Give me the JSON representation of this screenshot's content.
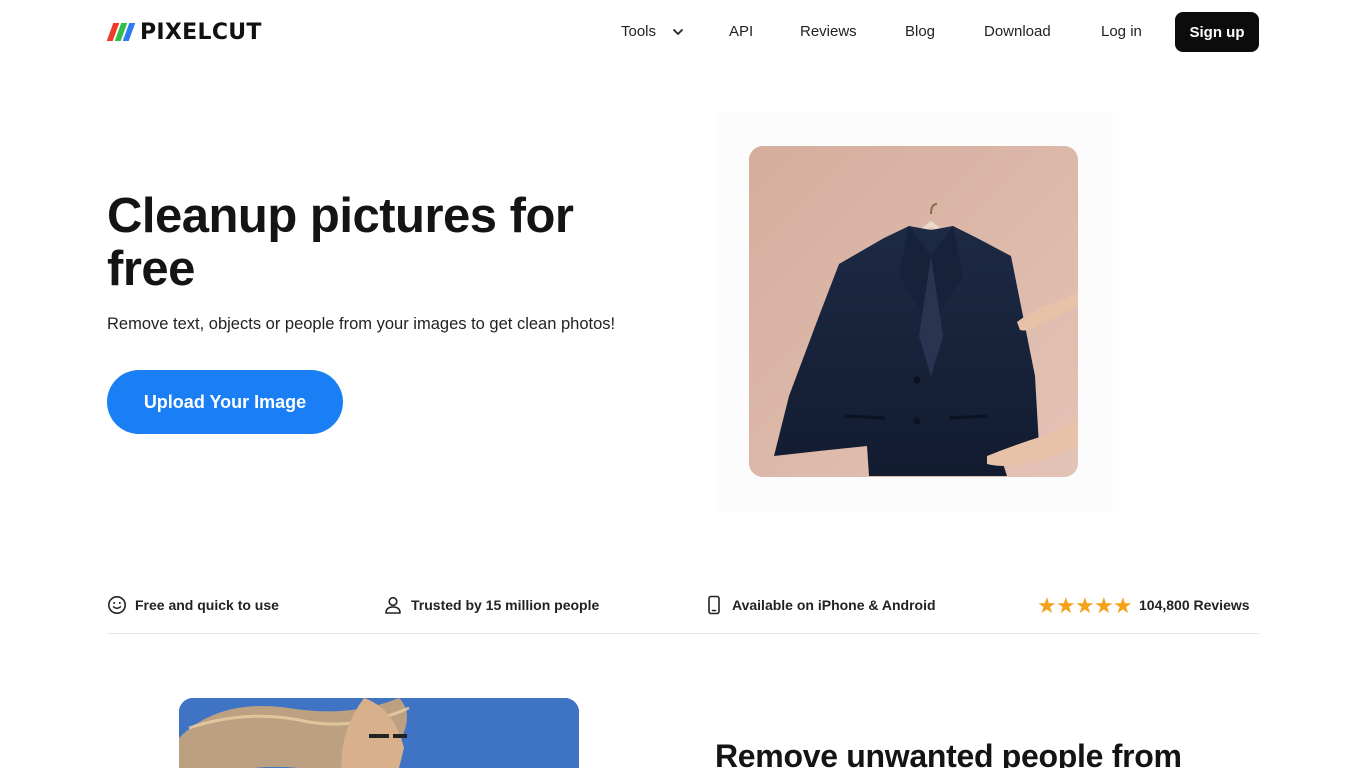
{
  "brand": {
    "name": "PIXELCUT"
  },
  "nav": {
    "items": [
      {
        "label": "Tools"
      },
      {
        "label": "API"
      },
      {
        "label": "Reviews"
      },
      {
        "label": "Blog"
      },
      {
        "label": "Download"
      },
      {
        "label": "Log in"
      }
    ],
    "signup_label": "Sign up"
  },
  "hero": {
    "title": "Cleanup pictures for free",
    "subtitle": "Remove text, objects or people from your images to get clean photos!",
    "upload_label": "Upload Your Image",
    "image_icon": "jacket-photo"
  },
  "features": [
    {
      "icon": "smiley-icon",
      "label": "Free and quick to use"
    },
    {
      "icon": "user-icon",
      "label": "Trusted by 15 million people"
    },
    {
      "icon": "phone-icon",
      "label": "Available on iPhone & Android"
    },
    {
      "icon": "star-icon",
      "label": "104,800 Reviews",
      "stars": 5
    }
  ],
  "section2": {
    "title": "Remove unwanted people from"
  },
  "colors": {
    "accent": "#1a7ff5",
    "star": "#f5a11a",
    "signup_bg": "#0c0c0c"
  }
}
